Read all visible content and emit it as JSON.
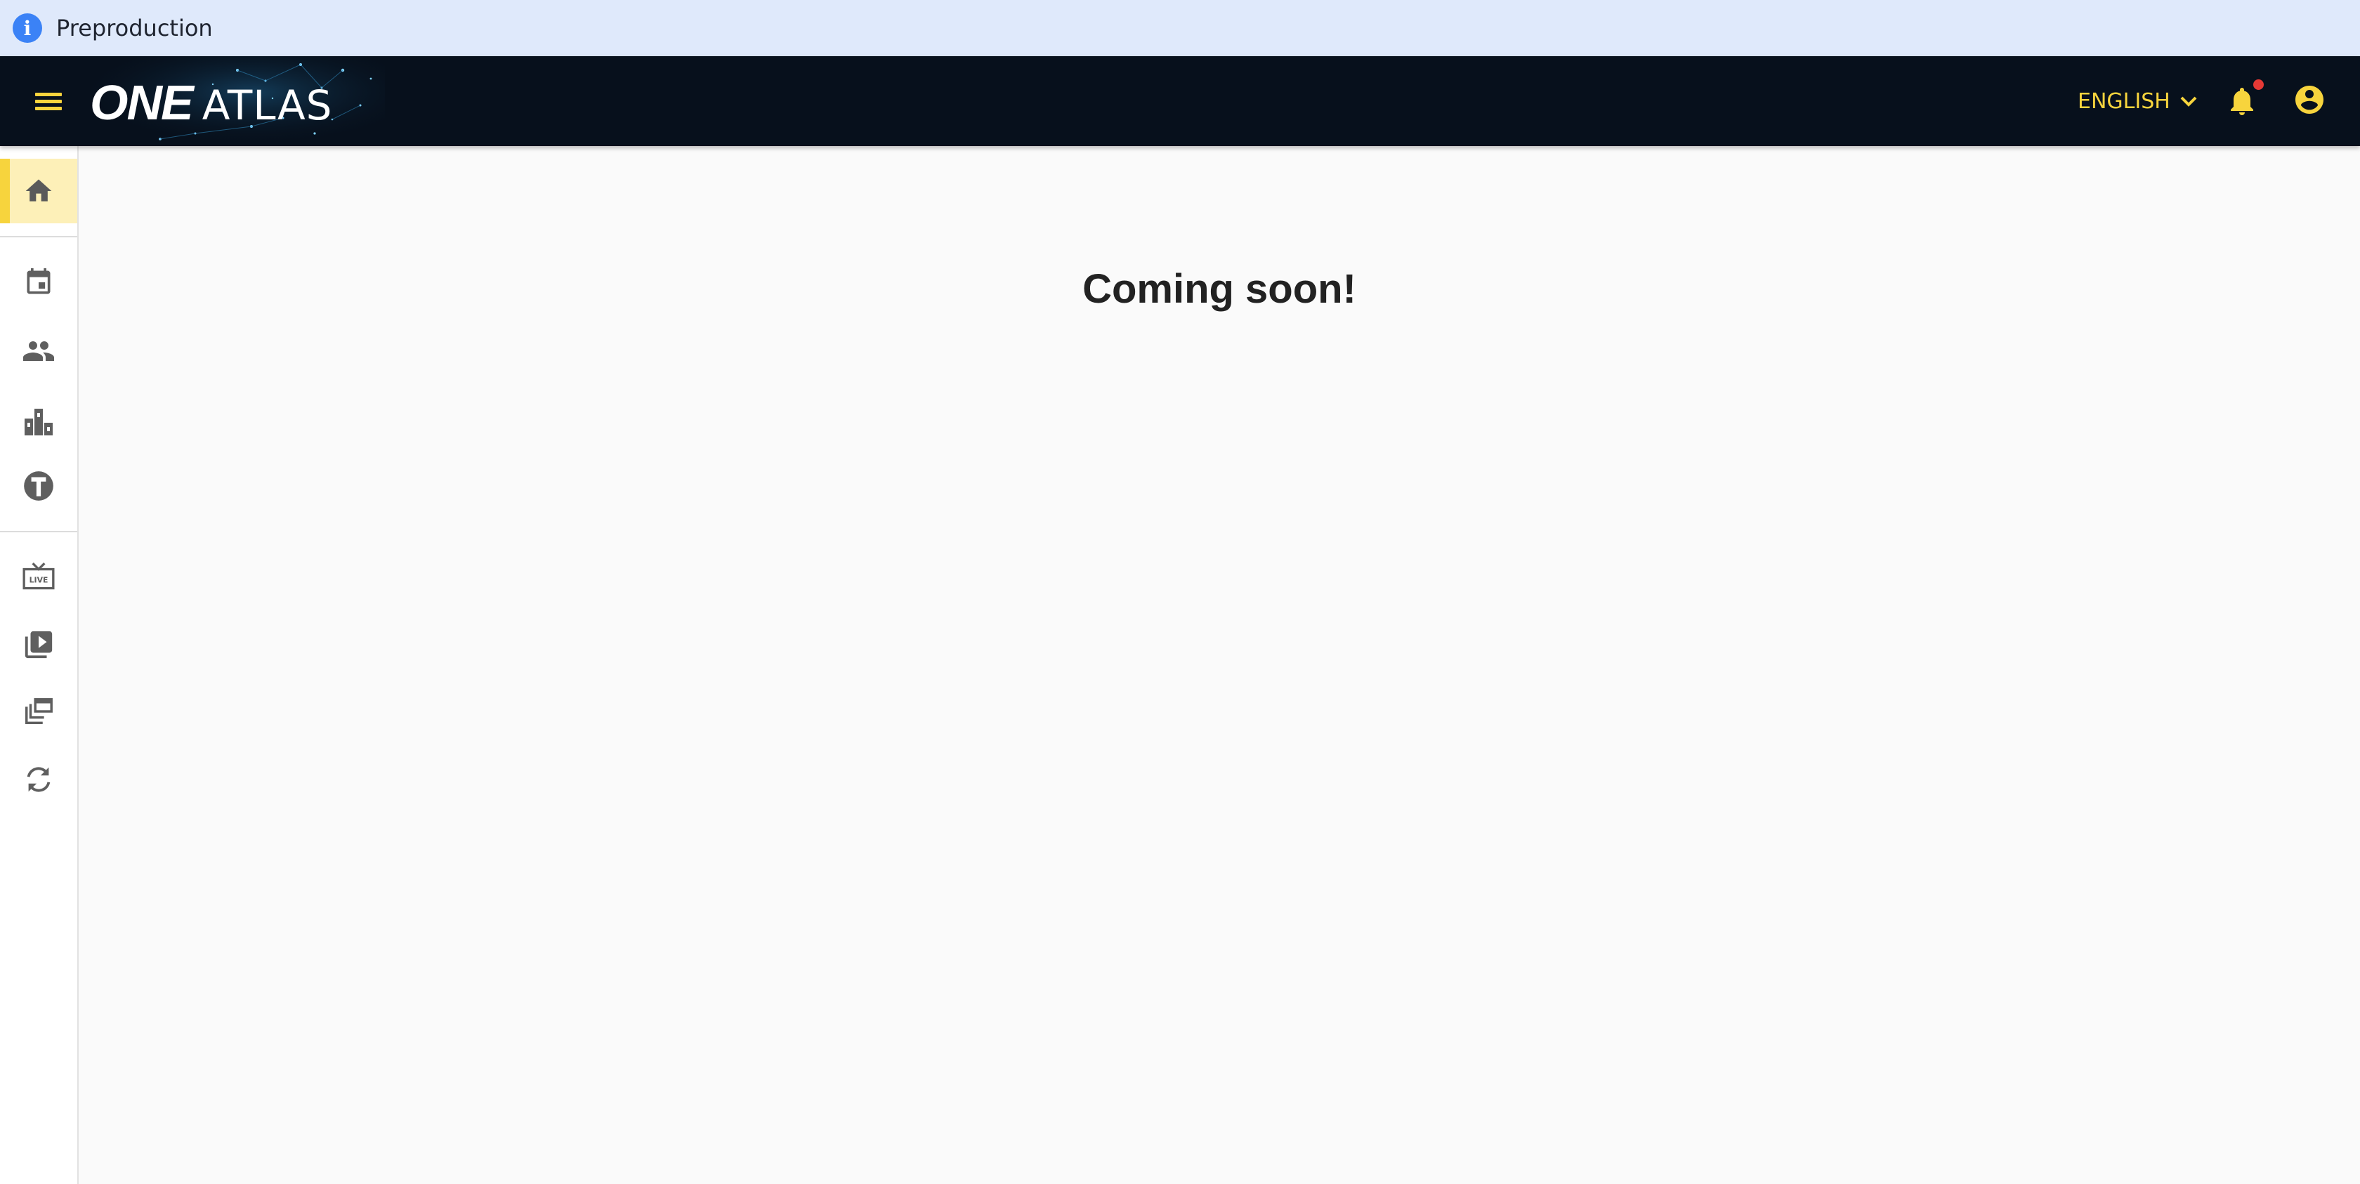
{
  "banner": {
    "icon": "info-icon",
    "label": "Preproduction"
  },
  "header": {
    "logo_primary": "ONE",
    "logo_secondary": "ATLAS",
    "language": "ENGLISH",
    "menu_icon": "hamburger-menu-icon",
    "notification_icon": "bell-icon",
    "account_icon": "account-circle-icon"
  },
  "sidebar": {
    "items": [
      {
        "name": "home",
        "icon": "home-icon",
        "active": true
      },
      {
        "name": "events",
        "icon": "calendar-icon",
        "active": false
      },
      {
        "name": "athletes",
        "icon": "people-icon",
        "active": false
      },
      {
        "name": "rankings",
        "icon": "podium-icon",
        "active": false
      },
      {
        "name": "teams",
        "icon": "team-shield-icon",
        "active": false
      },
      {
        "name": "live",
        "icon": "live-tv-icon",
        "active": false
      },
      {
        "name": "videos",
        "icon": "video-library-icon",
        "active": false
      },
      {
        "name": "media",
        "icon": "media-collection-icon",
        "active": false
      },
      {
        "name": "sync",
        "icon": "sync-icon",
        "active": false
      }
    ],
    "live_badge_text": "LIVE"
  },
  "main": {
    "title": "Coming soon!"
  },
  "colors": {
    "accent": "#f7d43d",
    "header_bg": "#07101c",
    "banner_bg": "#dfe9fb",
    "active_nav_bg": "#fdf0b8",
    "notification_dot": "#e53935",
    "icon_gray": "#5f5f5f"
  }
}
